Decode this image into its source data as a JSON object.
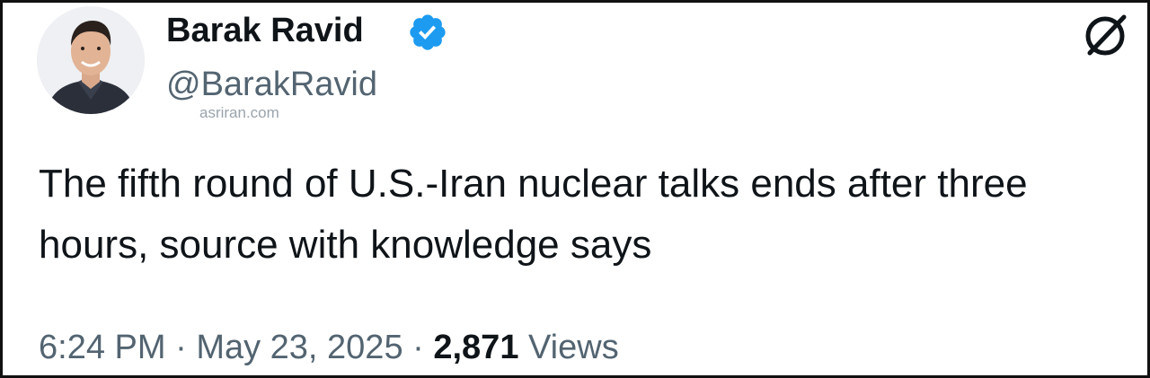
{
  "author": {
    "display_name": "Barak Ravid",
    "handle": "@BarakRavid",
    "verified": true,
    "avatar_icon": "profile-photo"
  },
  "watermark": "asriran.com",
  "tweet": {
    "text": "The fifth round of U.S.-Iran nuclear talks ends after three hours, source with knowledge says",
    "time": "6:24 PM",
    "separator": "·",
    "date": "May 23, 2025",
    "views_count": "2,871",
    "views_label": "Views"
  },
  "icons": {
    "verified": "verified-badge-icon",
    "logo": "x-logo-icon"
  },
  "colors": {
    "verified_blue": "#1d9bf0",
    "text_primary": "#0f1419",
    "text_secondary": "#536471"
  }
}
